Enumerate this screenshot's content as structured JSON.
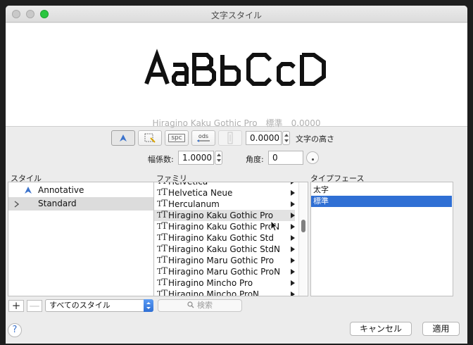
{
  "window": {
    "title": "文字スタイル"
  },
  "preview": {
    "sample_text": "AaBbCcD",
    "font_name": "Hiragino Kaku Gothic Pro",
    "style": "標準",
    "height": "0.0000"
  },
  "controls": {
    "text_height_value": "0.0000",
    "text_height_label": "文字の高さ",
    "width_factor_label": "幅係数:",
    "width_factor_value": "1.0000",
    "angle_label": "角度:",
    "angle_value": "0",
    "spacing_button": "spc",
    "backwards_button": "ods"
  },
  "columns": {
    "style": "スタイル",
    "family": "ファミリ",
    "typeface": "タイプフェース"
  },
  "styles": [
    {
      "label": "Annotative",
      "icon": "annotative-icon",
      "selected": false
    },
    {
      "label": "Standard",
      "icon": "chevron-right-icon",
      "selected": true
    }
  ],
  "families": [
    {
      "label": "Helvetica"
    },
    {
      "label": "Helvetica Neue"
    },
    {
      "label": "Herculanum"
    },
    {
      "label": "Hiragino Kaku Gothic Pro",
      "hover": true
    },
    {
      "label": "Hiragino Kaku Gothic ProN"
    },
    {
      "label": "Hiragino Kaku Gothic Std"
    },
    {
      "label": "Hiragino Kaku Gothic StdN"
    },
    {
      "label": "Hiragino Maru Gothic Pro"
    },
    {
      "label": "Hiragino Maru Gothic ProN"
    },
    {
      "label": "Hiragino Mincho Pro"
    },
    {
      "label": "Hiragino Mincho ProN"
    }
  ],
  "typefaces": [
    {
      "label": "太字",
      "selected": false
    },
    {
      "label": "標準",
      "selected": true
    }
  ],
  "bottom": {
    "add": "+",
    "remove": "—",
    "filter_value": "すべてのスタイル",
    "search_placeholder": "検索",
    "help": "?",
    "cancel": "キャンセル",
    "apply": "適用"
  },
  "colors": {
    "accent": "#2f6fd4",
    "traffic_light_green": "#2ac640"
  }
}
